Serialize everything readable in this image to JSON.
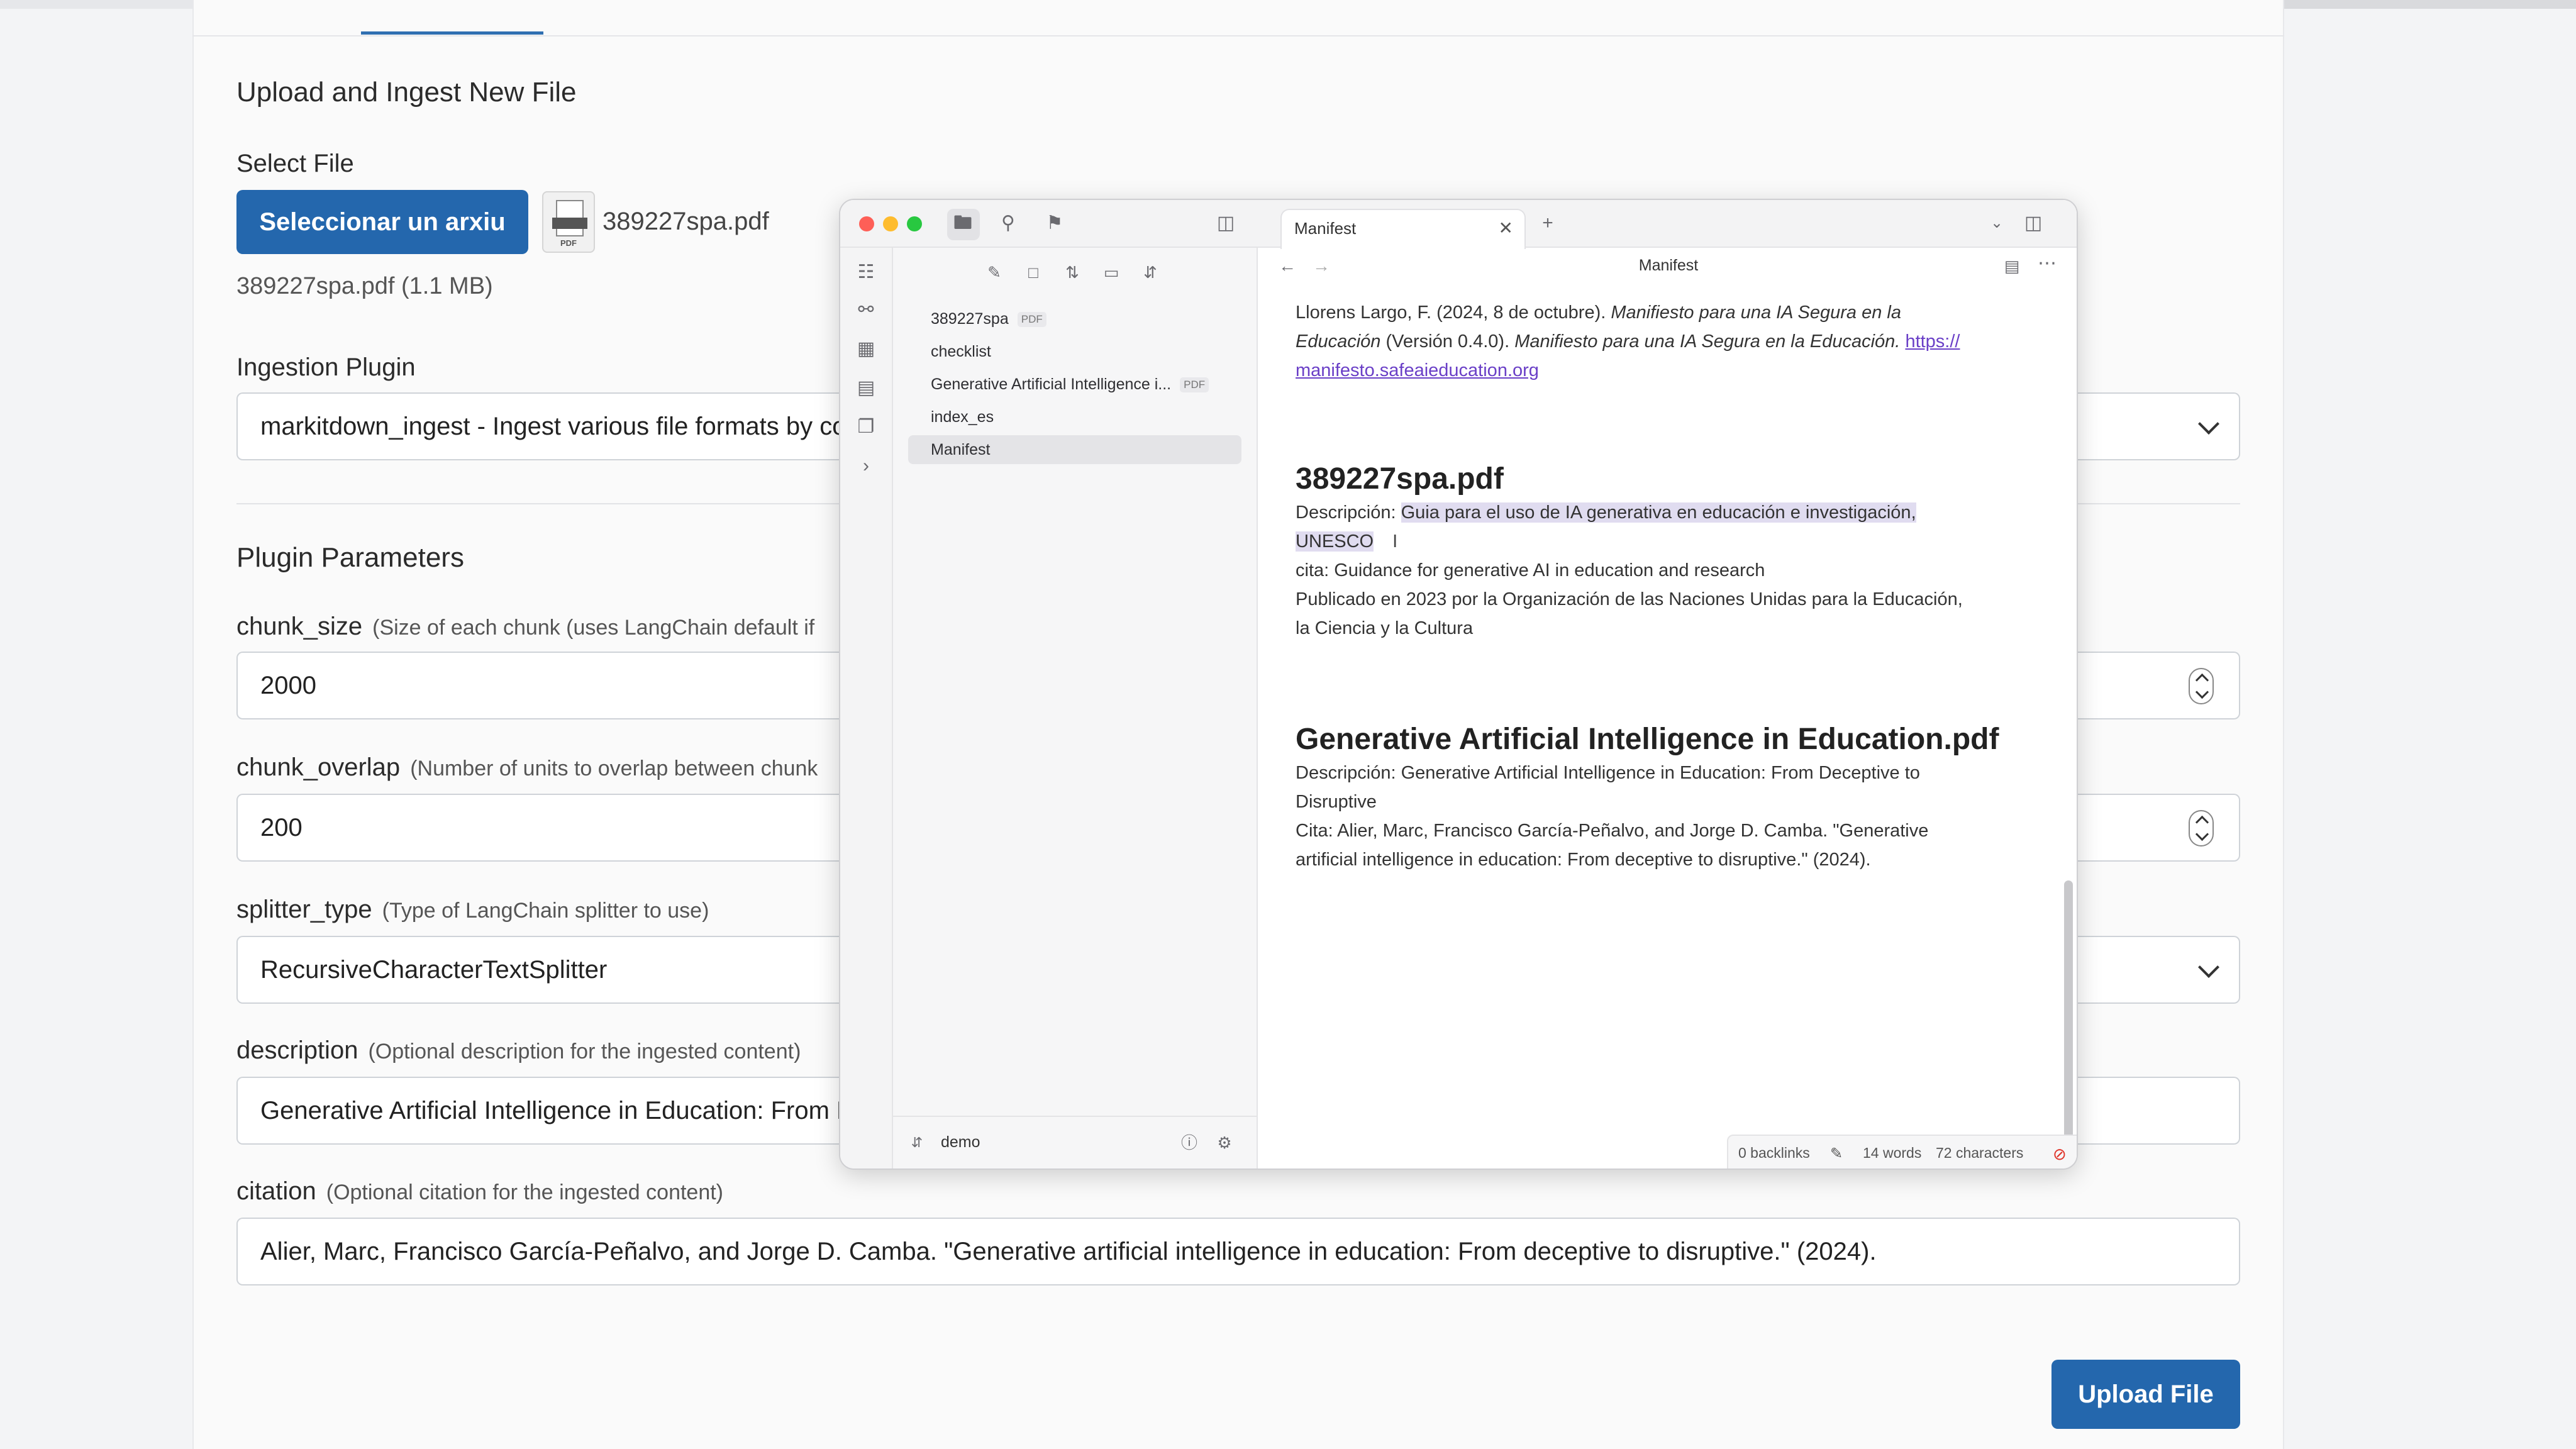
{
  "form": {
    "upload_title": "Upload and Ingest New File",
    "select_file_label": "Select File",
    "select_file_button": "Seleccionar un arxiu",
    "selected_filename": "389227spa.pdf",
    "selected_info": "389227spa.pdf (1.1 MB)",
    "ingestion_plugin_label": "Ingestion Plugin",
    "ingestion_plugin_value": "markitdown_ingest - Ingest various file formats by co",
    "plugin_params_title": "Plugin Parameters",
    "params": [
      {
        "name": "chunk_size",
        "hint": "(Size of each chunk (uses LangChain default if",
        "value": "2000"
      },
      {
        "name": "chunk_overlap",
        "hint": "(Number of units to overlap between chunk",
        "value": "200"
      },
      {
        "name": "splitter_type",
        "hint": "(Type of LangChain splitter to use)",
        "value": "RecursiveCharacterTextSplitter"
      },
      {
        "name": "description",
        "hint": "(Optional description for the ingested content)",
        "value": "Generative Artificial Intelligence in Education: From D"
      },
      {
        "name": "citation",
        "hint": "(Optional citation for the ingested content)",
        "value": "Alier, Marc, Francisco García-Peñalvo, and Jorge D. Camba. \"Generative artificial intelligence in education: From deceptive to disruptive.\" (2024)."
      }
    ],
    "upload_button": "Upload File"
  },
  "notes_window": {
    "files": [
      {
        "name": "389227spa",
        "badge": "PDF"
      },
      {
        "name": "checklist",
        "badge": ""
      },
      {
        "name": "Generative Artificial Intelligence i...",
        "badge": "PDF"
      },
      {
        "name": "index_es",
        "badge": ""
      },
      {
        "name": "Manifest",
        "badge": ""
      }
    ],
    "vault_name": "demo",
    "tab_title": "Manifest",
    "note_title": "Manifest",
    "content": {
      "ref_plain_1": "Llorens Largo, F. (2024, 8 de octubre). ",
      "ref_italic_1": "Manifiesto para una IA Segura en la",
      "ref_italic_2": "Educación",
      "ref_plain_2": " (Versión 0.4.0). ",
      "ref_italic_3": "Manifiesto para una IA Segura en la Educación.",
      "ref_link_1": "https://",
      "ref_link_2": "manifesto.safeaieducation.org",
      "h1": "389227spa.pdf",
      "desc_label_1": "Descripción: ",
      "desc_sel_1": "Guia para el uso de IA generativa en educación e investigación,",
      "desc_sel_2": "UNESCO",
      "cita_1": "cita: Guidance for generative AI in education and research",
      "pub_1": "Publicado en 2023 por la Organización de las Naciones Unidas para la Educación,",
      "pub_2": "la Ciencia y la Cultura",
      "h2": "Generative Artificial Intelligence in Education.pdf",
      "desc2_1": "Descripción: Generative Artificial Intelligence in Education: From Deceptive to",
      "desc2_2": "Disruptive",
      "cita2_1": "Cita: Alier, Marc, Francisco García-Peñalvo, and Jorge D. Camba. \"Generative",
      "cita2_2": "artificial intelligence in education: From deceptive to disruptive.\" (2024)."
    },
    "status": {
      "backlinks": "0 backlinks",
      "words": "14 words",
      "characters": "72 characters"
    }
  },
  "colors": {
    "primary": "#2467ad",
    "close": "#fe5f57",
    "minimize": "#febc2e",
    "zoom": "#28c840",
    "link": "#6a3fc7",
    "selection": "#e0dcf0"
  }
}
